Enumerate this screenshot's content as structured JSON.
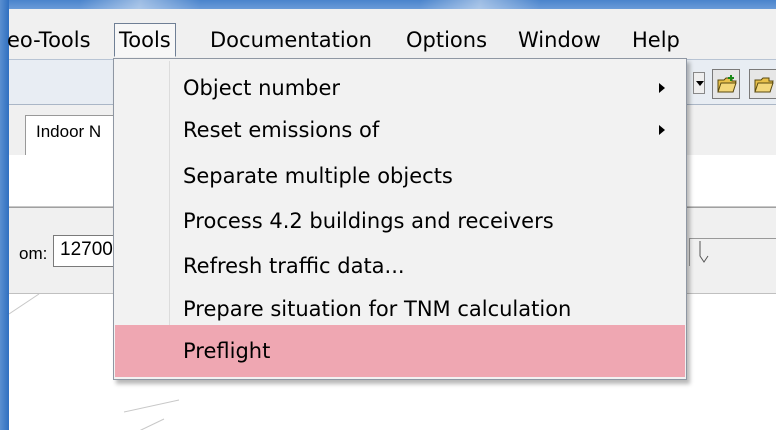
{
  "menubar": {
    "items": [
      {
        "label": "eo-Tools"
      },
      {
        "label": "Tools"
      },
      {
        "label": "Documentation"
      },
      {
        "label": "Options"
      },
      {
        "label": "Window"
      },
      {
        "label": "Help"
      }
    ]
  },
  "tools_menu": {
    "items": [
      {
        "label": "Object number",
        "submenu": true
      },
      {
        "label": "Reset emissions of",
        "submenu": true
      },
      {
        "label": "Separate multiple objects"
      },
      {
        "label": "Process 4.2 buildings and receivers"
      },
      {
        "label": "Refresh traffic data..."
      },
      {
        "label": "Prepare situation for TNM calculation"
      },
      {
        "label": "Preflight",
        "highlighted": true
      }
    ],
    "highlight_color": "#efa7b2"
  },
  "tab": {
    "label": "Indoor N"
  },
  "zoom": {
    "label": "om:",
    "value": "12700"
  },
  "colors": {
    "frame": "#2f6fc0",
    "menu_background": "#f2f2f2",
    "highlight": "#efa7b2"
  }
}
